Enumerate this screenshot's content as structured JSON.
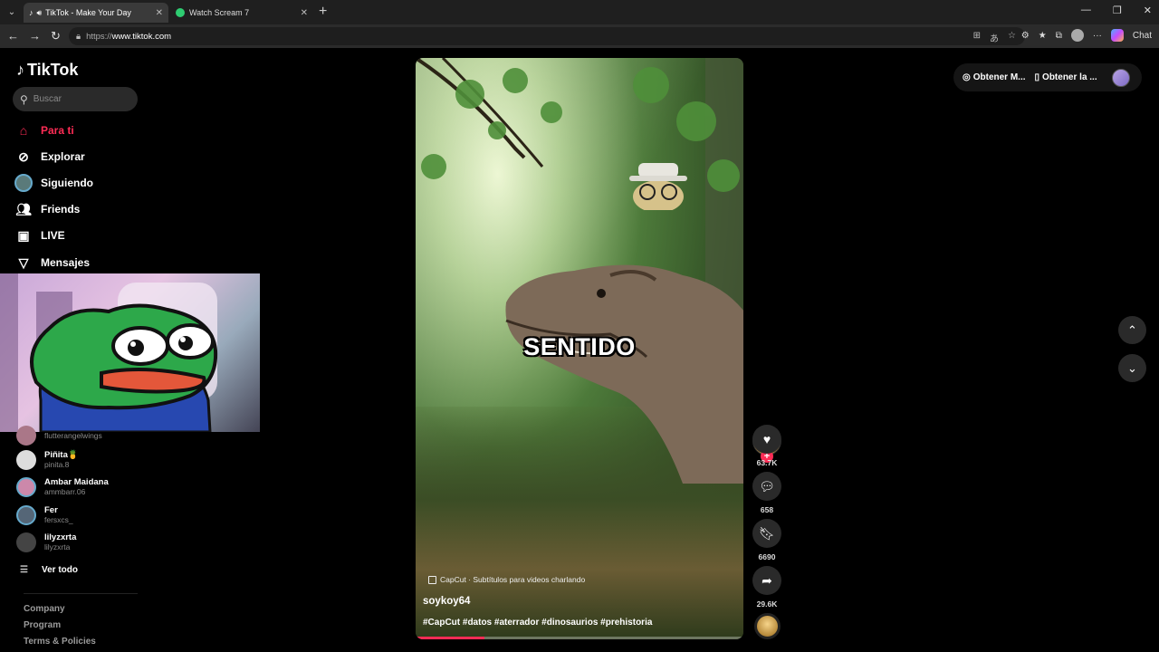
{
  "browser": {
    "tabs": [
      {
        "title": "TikTok - Make Your Day",
        "active": true
      },
      {
        "title": "Watch Scream 7",
        "active": false
      }
    ],
    "url_prefix": "https://",
    "url_host": "www.tiktok.com",
    "chat_label": "Chat"
  },
  "sidebar": {
    "brand": "TikTok",
    "search_placeholder": "Buscar",
    "nav": [
      {
        "label": "Para ti",
        "icon": "home-icon",
        "active": true
      },
      {
        "label": "Explorar",
        "icon": "compass-icon"
      },
      {
        "label": "Siguiendo",
        "icon": "following-avatar"
      },
      {
        "label": "Friends",
        "icon": "friends-icon"
      },
      {
        "label": "LIVE",
        "icon": "live-icon"
      },
      {
        "label": "Mensajes",
        "icon": "send-icon"
      }
    ],
    "following": [
      {
        "name": "",
        "username": "flutterangelwings"
      },
      {
        "name": "Piñita🍍",
        "username": "pinita.8"
      },
      {
        "name": "Ambar Maidana",
        "username": "ammbarr.06"
      },
      {
        "name": "Fer",
        "username": "fersxcs_"
      },
      {
        "name": "lilyzxrta",
        "username": "lilyzxrta"
      }
    ],
    "see_all": "Ver todo",
    "footer_links": [
      "Company",
      "Program",
      "Terms & Policies"
    ]
  },
  "video": {
    "caption_overlay": "SENTIDO",
    "capcut_label": "CapCut · Subtítulos para videos charlando",
    "author": "soykoy64",
    "hashtags": "#CapCut #datos #aterrador #dinosaurios #prehistoria",
    "progress": 0.21
  },
  "actions": {
    "likes": "63.7K",
    "comments": "658",
    "saves": "6690",
    "shares": "29.6K"
  },
  "topbar": {
    "get_coins": "Obtener M...",
    "get_app": "Obtener la ..."
  }
}
